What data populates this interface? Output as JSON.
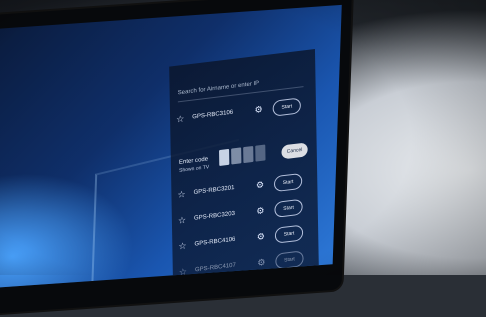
{
  "panel": {
    "search_placeholder": "Search for Airname or enter IP",
    "devices": [
      {
        "name": "GPS-RBC3106",
        "button": "Start"
      },
      {
        "name": "GPS-RBC3201",
        "button": "Start"
      },
      {
        "name": "GPS-RBC3203",
        "button": "Start"
      },
      {
        "name": "GPS-RBC4106",
        "button": "Start"
      },
      {
        "name": "GPS-RBC4107",
        "button": "Start"
      }
    ],
    "code_entry": {
      "title": "Enter code",
      "subtitle": "Shown on TV",
      "cancel_label": "Cancel"
    }
  }
}
